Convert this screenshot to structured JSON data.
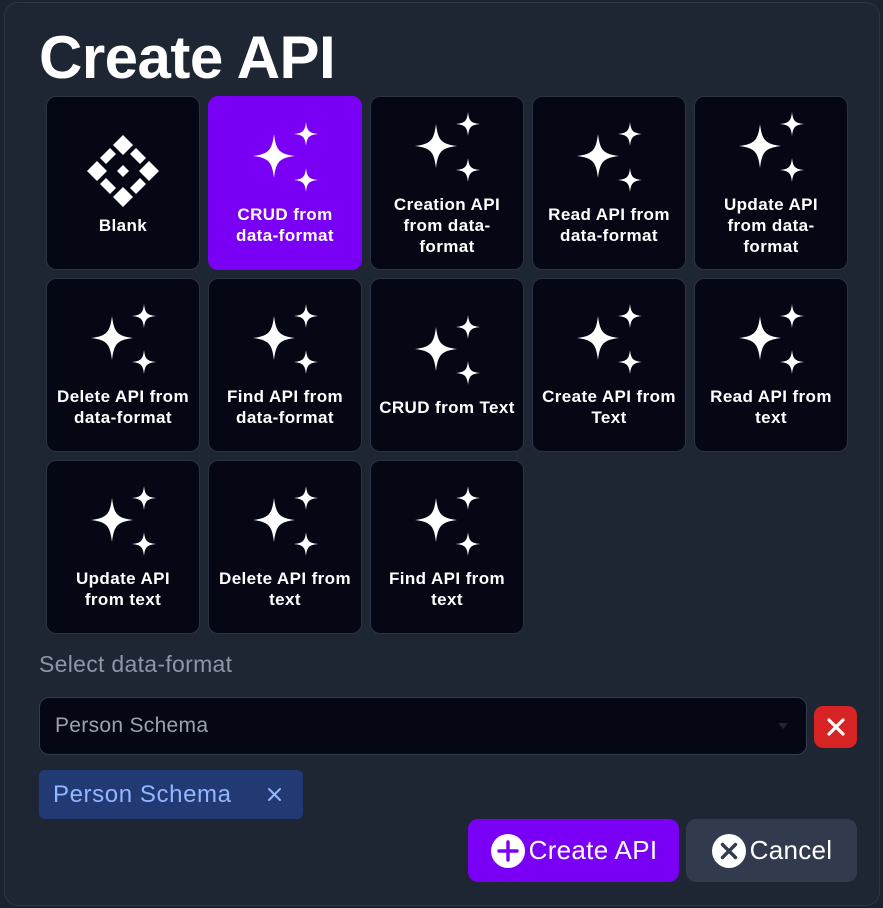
{
  "dialog": {
    "title": "Create API"
  },
  "templates": [
    {
      "label": "Blank",
      "icon": "blank-diamond-icon",
      "selected": false
    },
    {
      "label": "CRUD from data-format",
      "icon": "sparkles-icon",
      "selected": true
    },
    {
      "label": "Creation API from data-format",
      "icon": "sparkles-icon",
      "selected": false
    },
    {
      "label": "Read API from data-format",
      "icon": "sparkles-icon",
      "selected": false
    },
    {
      "label": "Update API from data-format",
      "icon": "sparkles-icon",
      "selected": false
    },
    {
      "label": "Delete API from data-format",
      "icon": "sparkles-icon",
      "selected": false
    },
    {
      "label": "Find API from data-format",
      "icon": "sparkles-icon",
      "selected": false
    },
    {
      "label": "CRUD from Text",
      "icon": "sparkles-icon",
      "selected": false
    },
    {
      "label": "Create API from Text",
      "icon": "sparkles-icon",
      "selected": false
    },
    {
      "label": "Read API from text",
      "icon": "sparkles-icon",
      "selected": false
    },
    {
      "label": "Update API from text",
      "icon": "sparkles-icon",
      "selected": false
    },
    {
      "label": "Delete API from text",
      "icon": "sparkles-icon",
      "selected": false
    },
    {
      "label": "Find API from text",
      "icon": "sparkles-icon",
      "selected": false
    }
  ],
  "data_format": {
    "label": "Select data-format",
    "selected_value": "Person Schema",
    "chips": [
      {
        "label": "Person Schema"
      }
    ]
  },
  "actions": {
    "create_label": "Create API",
    "cancel_label": "Cancel"
  },
  "colors": {
    "accent": "#7a00f5",
    "danger": "#d72323",
    "chip_bg": "#213a73",
    "chip_text": "#93b6ff",
    "tile_bg": "#050814"
  }
}
